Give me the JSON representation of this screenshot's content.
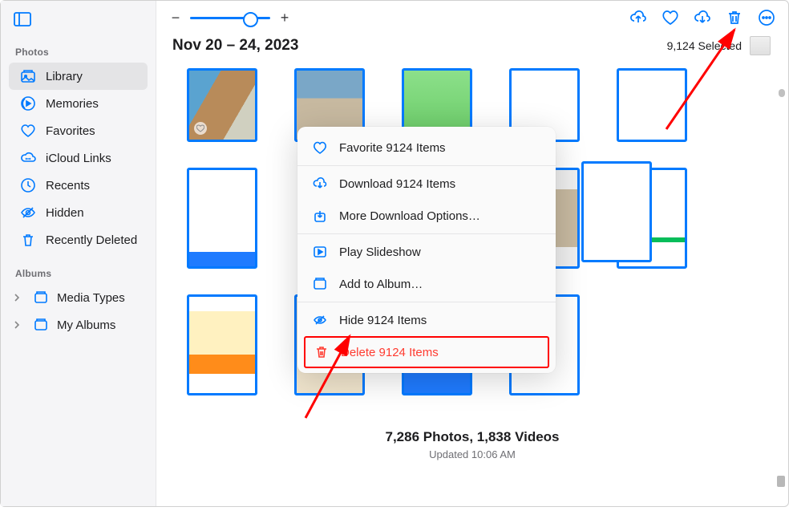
{
  "sidebar": {
    "sections": {
      "photos_title": "Photos",
      "albums_title": "Albums"
    },
    "items": [
      {
        "id": "library",
        "label": "Library",
        "selected": true
      },
      {
        "id": "memories",
        "label": "Memories"
      },
      {
        "id": "favorites",
        "label": "Favorites"
      },
      {
        "id": "icloud-links",
        "label": "iCloud Links"
      },
      {
        "id": "recents",
        "label": "Recents"
      },
      {
        "id": "hidden",
        "label": "Hidden"
      },
      {
        "id": "recently-deleted",
        "label": "Recently Deleted"
      }
    ],
    "albums": [
      {
        "id": "media-types",
        "label": "Media Types"
      },
      {
        "id": "my-albums",
        "label": "My Albums"
      }
    ]
  },
  "header": {
    "date_range": "Nov 20 – 24, 2023",
    "selected_text": "9,124 Selected"
  },
  "summary": {
    "counts": "7,286 Photos, 1,838 Videos",
    "updated": "Updated 10:06 AM"
  },
  "context_menu": {
    "favorite": "Favorite 9124 Items",
    "download": "Download 9124 Items",
    "more_download": "More Download Options…",
    "play_slideshow": "Play Slideshow",
    "add_to_album": "Add to Album…",
    "hide": "Hide 9124 Items",
    "delete": "Delete 9124 Items"
  },
  "zoom": {
    "minus": "−",
    "plus": "+"
  }
}
